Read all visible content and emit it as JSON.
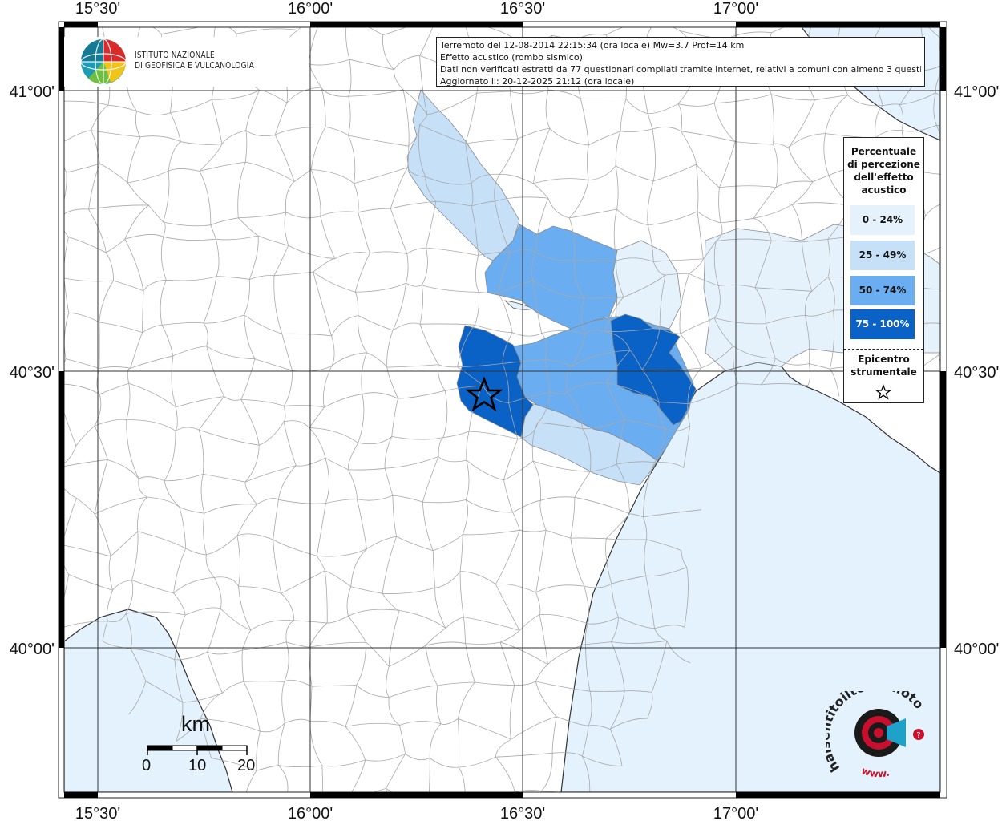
{
  "header": {
    "line1": "Terremoto del 12-08-2014 22:15:34 (ora locale) Mw=3.7 Prof=14 km",
    "line2": "Effetto acustico (rombo sismico)",
    "line3": "Dati non verificati estratti da 77 questionari compilati tramite Internet, relativi a comuni con almeno 3 questionari.",
    "line4": "Aggiornato il: 20-12-2025 21:12 (ora locale)"
  },
  "institute": {
    "line1": "ISTITUTO NAZIONALE",
    "line2": "DI GEOFISICA E VULCANOLOGIA"
  },
  "legend": {
    "title_lines": [
      "Percentuale",
      "di percezione",
      "dell'effetto",
      "acustico"
    ],
    "classes": [
      {
        "label": "0 - 24%",
        "color": "#e6f2fb"
      },
      {
        "label": "25 - 49%",
        "color": "#c6e0f8"
      },
      {
        "label": "50 - 74%",
        "color": "#6aaef1"
      },
      {
        "label": "75 - 100%",
        "color": "#0a62c6"
      }
    ],
    "epicenter_lines": [
      "Epicentro",
      "strumentale"
    ]
  },
  "axes": {
    "longitude_labels": [
      "15°30'",
      "16°00'",
      "16°30'",
      "17°00'"
    ],
    "latitude_labels": [
      "41°00'",
      "40°30'",
      "40°00'"
    ]
  },
  "scale_bar": {
    "unit": "km",
    "ticks": [
      "0",
      "10",
      "20"
    ]
  },
  "site_logo": {
    "text": "haisentitoilterremoto.it",
    "url_text": "www."
  },
  "colors": {
    "sea": "#e3f2fc",
    "land": "#ffffff",
    "grid": "#333333",
    "boundary": "#9a9a9a"
  }
}
